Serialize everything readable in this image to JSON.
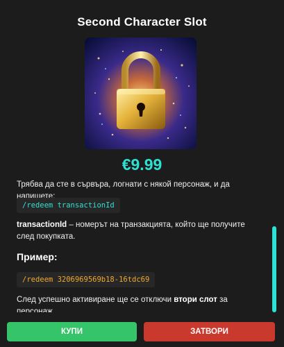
{
  "modal": {
    "title": "Second Character Slot",
    "price": "€9.99",
    "instruction_text": "Трябва да сте в сървъра, логнати с някой персонаж, и да напишете:",
    "command_code": "/redeem transactionId",
    "transaction_term": "transactionId",
    "transaction_desc": " – номерът на транзакцията, който ще получите след покупката.",
    "example_heading": "Пример:",
    "example_code": "/redeem 3206969569b18-16tdc69",
    "activation_before": "След успешно активиране ще се отключи ",
    "activation_bold": "втори слот",
    "activation_after": " за персонаж."
  },
  "buttons": {
    "buy_label": "КУПИ",
    "close_label": "ЗАТВОРИ"
  },
  "colors": {
    "accent": "#2de2d2",
    "buy": "#36c46a",
    "close": "#c9392e",
    "example_code": "#f0a830"
  },
  "icons": {
    "product_image": "golden-padlock-icon"
  }
}
